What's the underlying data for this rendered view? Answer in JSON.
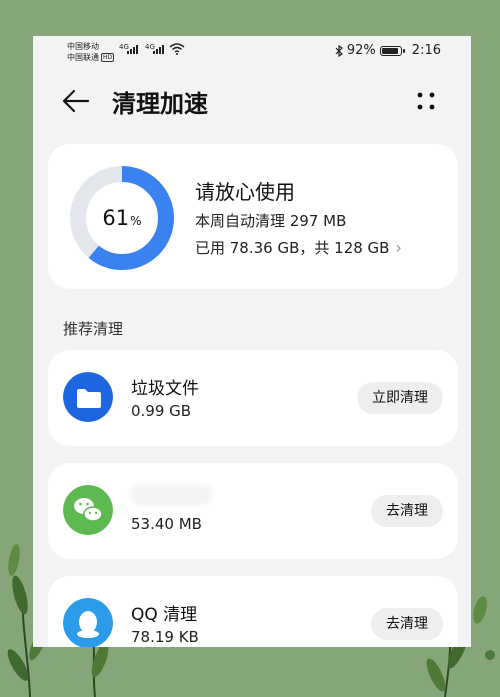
{
  "status_bar": {
    "carrier_1": "中国移动",
    "carrier_2": "中国联通",
    "hd_badge": "HD",
    "signal_1": "4G",
    "signal_2": "4G",
    "battery_percent": "92%",
    "battery_level": 0.92,
    "time": "2:16"
  },
  "header": {
    "title": "清理加速",
    "back_icon": "arrow-left-icon",
    "more_icon": "more-dots-icon"
  },
  "summary": {
    "percent_value": 61,
    "percent_number": "61",
    "percent_sign": "%",
    "title": "请放心使用",
    "weekly_clean": "本周自动清理 297 MB",
    "usage": "已用 78.36 GB，共 128 GB",
    "ring_color": "#3a82f0"
  },
  "section_title": "推荐清理",
  "items": [
    {
      "name": "垃圾文件",
      "size": "0.99 GB",
      "button": "立即清理",
      "icon": "folder-icon",
      "icon_color": "#1d66e0"
    },
    {
      "name": "",
      "size": "53.40 MB",
      "button": "去清理",
      "icon": "wechat-icon",
      "icon_color": "#5cb94f"
    },
    {
      "name": "QQ 清理",
      "size": "78.19 KB",
      "button": "去清理",
      "icon": "qq-icon",
      "icon_color": "#2b9bea"
    }
  ]
}
